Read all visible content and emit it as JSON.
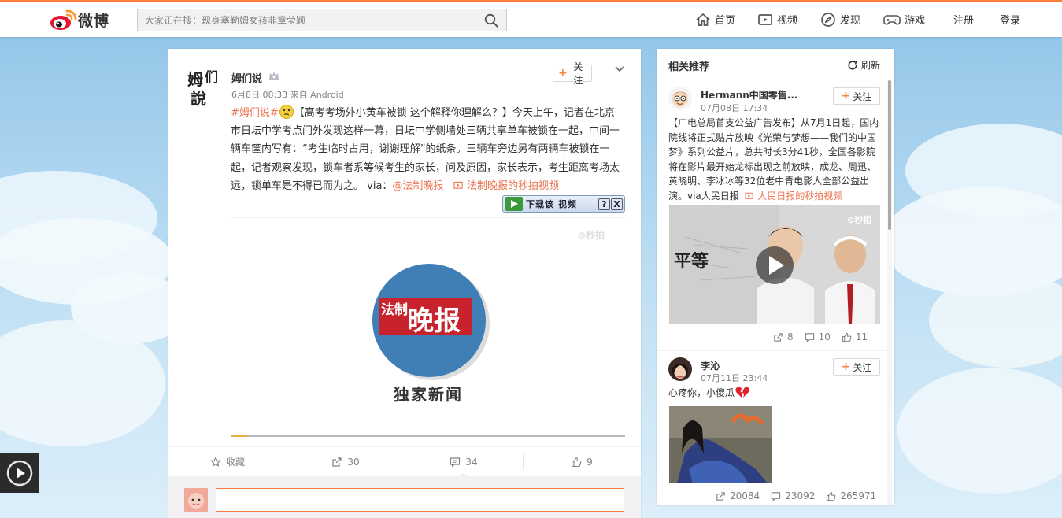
{
  "header": {
    "logo_text": "微博",
    "search_placeholder": "大家正在搜：现身塞勒姆女孩非章莹颖",
    "nav": [
      {
        "label": "首页",
        "icon": "home-icon"
      },
      {
        "label": "视频",
        "icon": "video-icon"
      },
      {
        "label": "发现",
        "icon": "compass-icon"
      },
      {
        "label": "游戏",
        "icon": "gamepad-icon"
      }
    ],
    "register": "注册",
    "login": "登录"
  },
  "post": {
    "author": "姆们说",
    "avatar_text": [
      "姆",
      "们",
      "說"
    ],
    "meta": "6月8日 08:33 来自 Android",
    "follow_label": "关注",
    "hashtag": "#姆们说#",
    "text_main": "【高考考场外小黄车被锁  这个解释你理解么？】今天上午，记者在北京市日坛中学考点门外发现这样一幕，日坛中学侧墙处三辆共享单车被锁在一起，中间一辆车筐内写有：“考生临时占用，谢谢理解”的纸条。三辆车旁边另有两辆车被锁在一起，记者观察发现，锁车者系等候考生的家长，问及原因，家长表示，考生距离考场太远，锁单车是不得已而为之。 via：",
    "via_user": "@法制晚报",
    "video_link": "法制晚报的秒拍视频",
    "download_label": "下载该  视频",
    "download_help": "?",
    "download_close": "X",
    "video_watermark": "秒拍",
    "video_logo_top": "法制",
    "video_logo_main": "晚报",
    "video_caption": "独家新闻",
    "video_progress": 0.04,
    "actions": {
      "favorite": "收藏",
      "repost": "30",
      "comment": "34",
      "like": "9"
    }
  },
  "side": {
    "title": "相关推荐",
    "refresh": "刷新",
    "items": [
      {
        "name": "Hermann中国零售...",
        "time": "07月08日 17:34",
        "follow_label": "关注",
        "text_main": "【广电总局首支公益广告发布】从7月1日起，国内院线将正式贴片放映《光荣与梦想——我们的中国梦》系列公益片，总共时长3分41秒，全国各影院将在影片最开始龙标出现之前放映，成龙、周迅、黄晓明、李冰冰等32位老中青电影人全部公益出演。via人民日报",
        "link": "人民日报的秒拍视频",
        "image_watermark": "秒拍",
        "image_text": "平等",
        "repost": "8",
        "comment": "10",
        "like": "11"
      },
      {
        "name": "李沁",
        "time": "07月11日 23:44",
        "follow_label": "关注",
        "text_main": "心疼你，小傻瓜",
        "repost": "20084",
        "comment": "23092",
        "like": "265971"
      }
    ]
  },
  "colors": {
    "accent": "#fa7d3c",
    "link": "#eb7350",
    "follow_plus": "#ff8140",
    "video_logo_blue": "#3f7fb6",
    "video_logo_red": "#c8232c"
  }
}
